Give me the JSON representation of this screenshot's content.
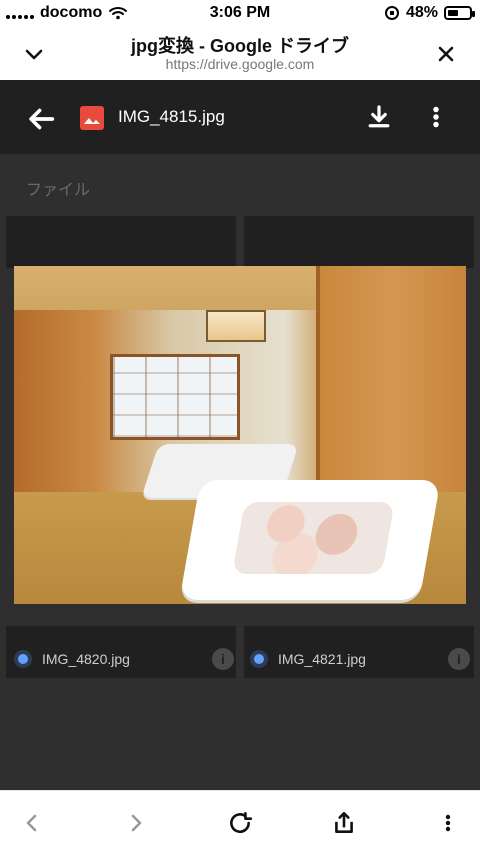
{
  "status_bar": {
    "carrier": "docomo",
    "time": "3:06 PM",
    "battery_percent": "48%",
    "battery_level": 0.48,
    "icons": [
      "wifi-icon",
      "orientation-lock-icon",
      "battery-icon"
    ]
  },
  "browser_header": {
    "title": "jpg変換 - Google ドライブ",
    "url": "https://drive.google.com",
    "left_icon": "chevron-down-icon",
    "right_icon": "close-icon"
  },
  "viewer": {
    "file_name": "IMG_4815.jpg",
    "actions": [
      "download-icon",
      "more-vert-icon"
    ],
    "back_icon": "back-arrow-icon"
  },
  "drive": {
    "section_label": "ファイル",
    "tiles": [
      {
        "name": "IMG_4820.jpg",
        "type_icon": "image-icon",
        "info_icon": "info-icon"
      },
      {
        "name": "IMG_4821.jpg",
        "type_icon": "image-icon",
        "info_icon": "info-icon"
      }
    ]
  },
  "bottom_toolbar": {
    "icons": [
      "back-icon",
      "forward-icon",
      "reload-icon",
      "share-icon",
      "more-vert-icon"
    ]
  },
  "colors": {
    "viewer_bg": "#202020",
    "app_bg": "#2f2f2f",
    "accent_red": "#e84a3c"
  }
}
